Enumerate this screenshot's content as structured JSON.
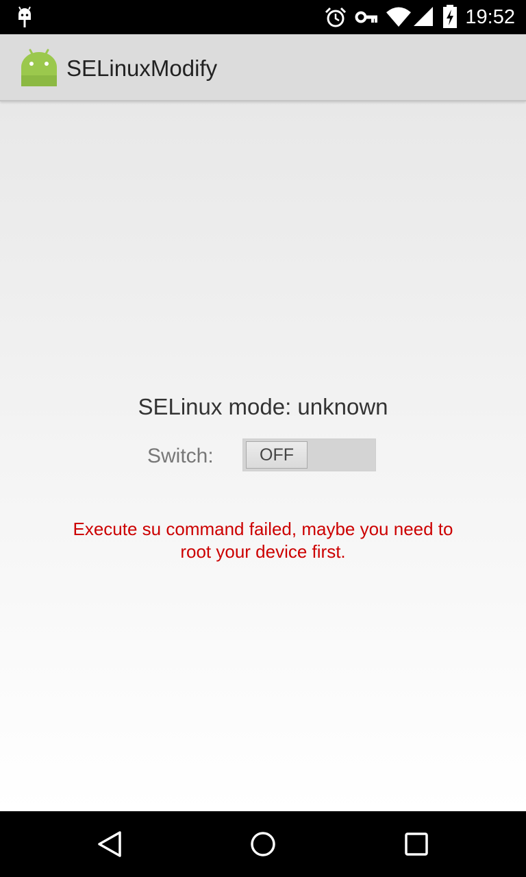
{
  "status_bar": {
    "time": "19:52",
    "icons": [
      "android-debug-icon",
      "alarm-icon",
      "vpn-key-icon",
      "wifi-icon",
      "signal-icon",
      "battery-charging-icon"
    ]
  },
  "action_bar": {
    "title": "SELinuxModify",
    "icon": "android-app-icon"
  },
  "main": {
    "mode_text": "SELinux mode: unknown",
    "switch_label": "Switch:",
    "toggle_text": "OFF",
    "error_message": "Execute su command failed, maybe you need to root your device first."
  },
  "nav_bar": {
    "buttons": [
      "back-icon",
      "home-icon",
      "recents-icon"
    ]
  },
  "colors": {
    "error": "#cc0000",
    "app_icon": "#9bc84d",
    "action_bar": "#dcdcdc"
  }
}
